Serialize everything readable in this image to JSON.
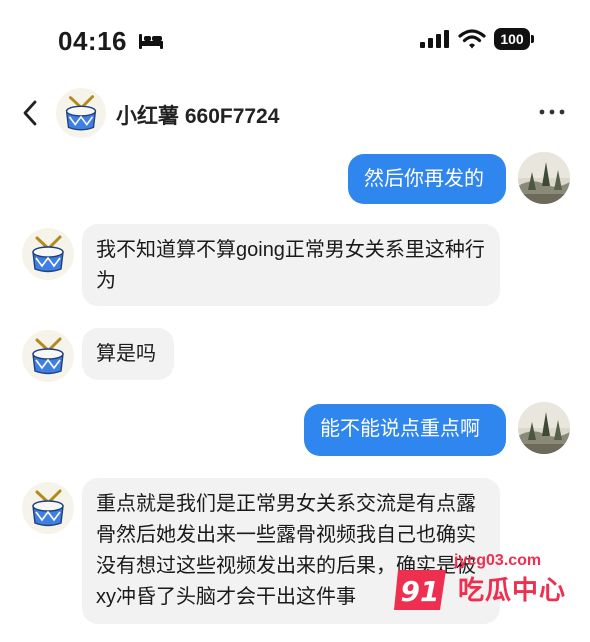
{
  "status_bar": {
    "time": "04:16",
    "battery": "100"
  },
  "header": {
    "contact_name": "小红薯 660F7724"
  },
  "messages": [
    {
      "direction": "out",
      "text": "然后你再发的"
    },
    {
      "direction": "in",
      "text": "我不知道算不算going正常男女关系里这种行为"
    },
    {
      "direction": "in",
      "text": "算是吗"
    },
    {
      "direction": "out",
      "text": "能不能说点重点啊"
    },
    {
      "direction": "in",
      "text": "重点就是我们是正常男女关系交流是有点露骨然后她发出来一些露骨视频我自己也确实没有想过这些视频发出来的后果，确实是被xy冲昏了头脑才会干出这件事"
    }
  ],
  "watermark": {
    "url": "jycg03.com",
    "badge": "91",
    "text": "吃瓜中心"
  },
  "colors": {
    "outgoing_bubble": "#2f86ee",
    "incoming_bubble": "#f2f2f2",
    "watermark": "#ee2f4f"
  },
  "icons": [
    "bed-icon",
    "signal-icon",
    "wifi-icon",
    "back-icon",
    "more-icon",
    "drum-avatar-icon",
    "landscape-avatar"
  ]
}
